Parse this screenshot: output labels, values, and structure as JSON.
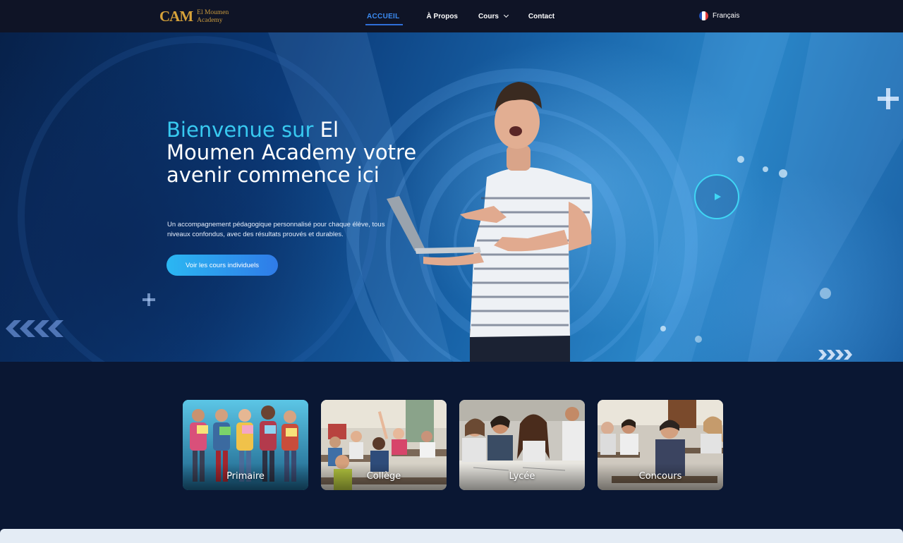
{
  "brand": {
    "mark": "CAM",
    "line1": "El Moumen",
    "line2": "Academy",
    "color": "#d6a23a"
  },
  "nav": {
    "items": [
      {
        "label": "ACCUEIL",
        "active": true
      },
      {
        "label": "À Propos"
      },
      {
        "label": "Cours",
        "dropdown": true
      },
      {
        "label": "Contact"
      }
    ],
    "language": "Français",
    "language_icon": "france-flag-icon"
  },
  "hero": {
    "title_highlight": "Bienvenue sur",
    "title_rest": " El Moumen Academy votre avenir commence ici",
    "subtitle": "Un accompagnement pédagogique personnalisé pour chaque élève, tous niveaux confondus, avec des résultats prouvés et durables.",
    "cta": "Voir les cours individuels",
    "play_icon": "play-icon",
    "accent": "#38c9f0"
  },
  "categories": [
    {
      "label": "Primaire"
    },
    {
      "label": "Collège"
    },
    {
      "label": "Lycée"
    },
    {
      "label": "Concours"
    }
  ]
}
